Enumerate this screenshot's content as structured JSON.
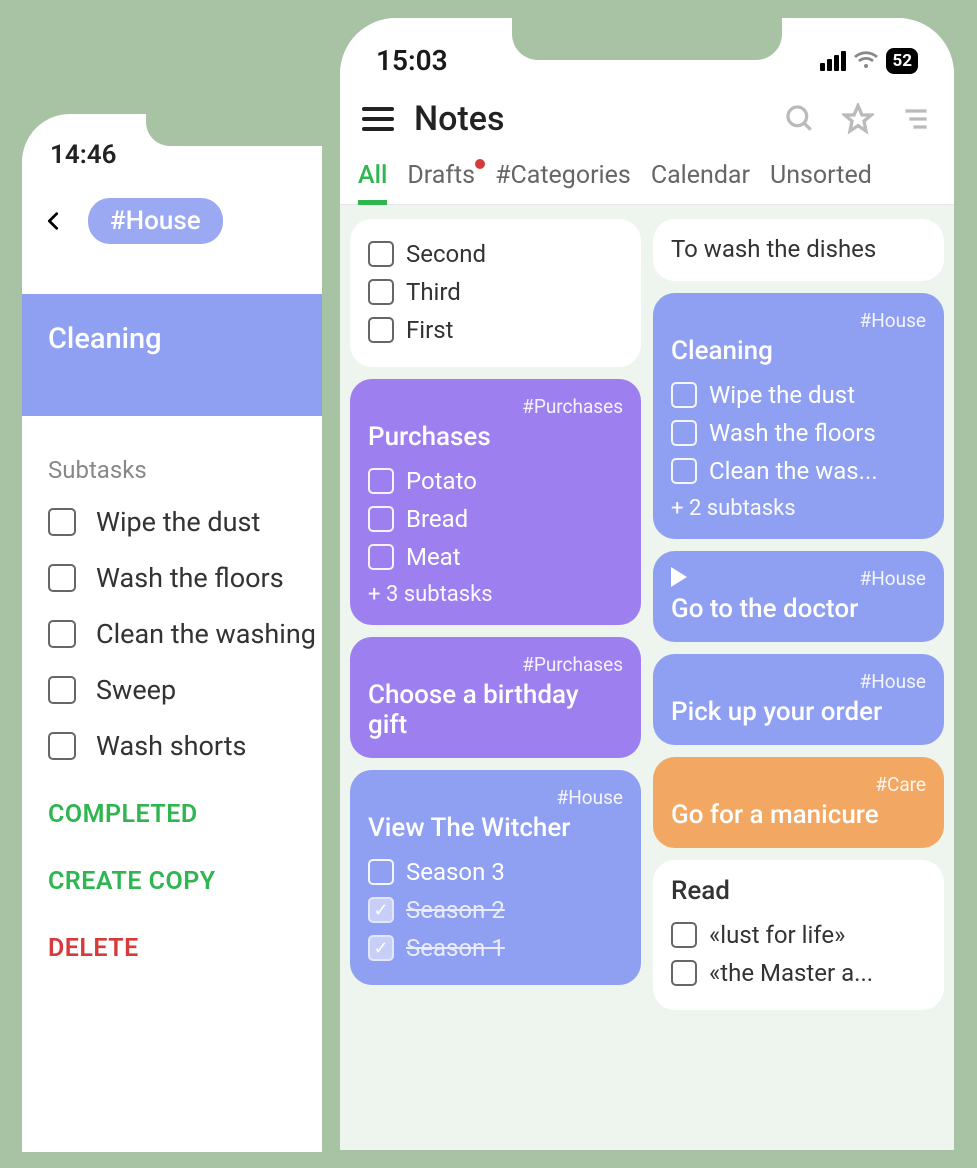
{
  "back_phone": {
    "status_time": "14:46",
    "tag": "#House",
    "card_title": "Cleaning",
    "subtasks_label": "Subtasks",
    "subtasks": [
      "Wipe the dust",
      "Wash the floors",
      "Clean the washing",
      "Sweep",
      "Wash shorts"
    ],
    "actions": {
      "completed": "COMPLETED",
      "copy": "CREATE COPY",
      "delete": "DELETE"
    }
  },
  "front_phone": {
    "status_time": "15:03",
    "battery": "52",
    "page_title": "Notes",
    "tabs": [
      "All",
      "Drafts",
      "#Categories",
      "Calendar",
      "Unsorted"
    ],
    "col_left": {
      "check_card": {
        "items": [
          "Second",
          "Third",
          "First"
        ]
      },
      "purchases": {
        "tag": "#Purchases",
        "title": "Purchases",
        "items": [
          "Potato",
          "Bread",
          "Meat"
        ],
        "more": "+ 3 subtasks"
      },
      "gift": {
        "tag": "#Purchases",
        "title": "Choose a birthday gift"
      },
      "witcher": {
        "tag": "#House",
        "title": "View The Witcher",
        "unchecked": "Season 3",
        "checked": [
          "Season 2",
          "Season 1"
        ]
      }
    },
    "col_right": {
      "dishes": "To wash the dishes",
      "cleaning": {
        "tag": "#House",
        "title": "Cleaning",
        "items": [
          "Wipe the dust",
          "Wash the floors",
          "Clean the was..."
        ],
        "more": "+ 2 subtasks"
      },
      "doctor": {
        "tag": "#House",
        "title": "Go to the doctor"
      },
      "order": {
        "tag": "#House",
        "title": "Pick up your order"
      },
      "manicure": {
        "tag": "#Care",
        "title": "Go for a manicure"
      },
      "read": {
        "title": "Read",
        "items": [
          "«lust for life»",
          "«the Master a..."
        ]
      }
    }
  }
}
